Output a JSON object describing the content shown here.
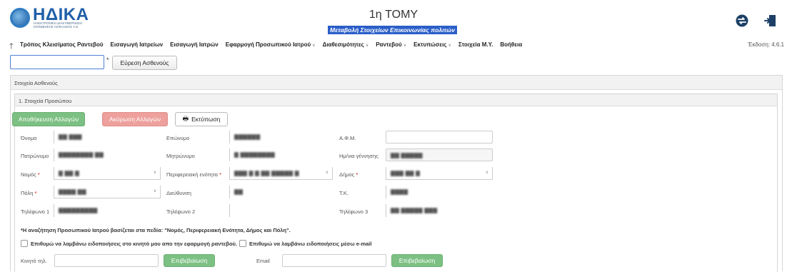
{
  "header": {
    "logo_text": "ΗΔΙΚΑ",
    "logo_subtitle": "ΗΛΕΚΤΡΟΝΙΚΗ ΔΙΑΚΥΒΕΡΝΗΣΗ ΚΟΙΝΩΝΙΚΗΣ ΑΣΦΑΛΙΣΗΣ Α.Ε.",
    "title": "1η TOMY",
    "subtitle": "Μεταβολή Στοιχείων Επικοινωνίας πολιτών",
    "icons": [
      "swap-icon",
      "exit-icon"
    ]
  },
  "menu": {
    "items": [
      {
        "label": "Τρόπος Κλεισίματος Ραντεβού",
        "dropdown": false
      },
      {
        "label": "Εισαγωγή Ιατρείων",
        "dropdown": false
      },
      {
        "label": "Εισαγωγή Ιατρών",
        "dropdown": false
      },
      {
        "label": "Εφαρμογή Προσωπικού Ιατρού",
        "dropdown": true
      },
      {
        "label": "Διαθεσιμότητες",
        "dropdown": true
      },
      {
        "label": "Ραντεβού",
        "dropdown": true
      },
      {
        "label": "Εκτυπώσεις",
        "dropdown": true
      },
      {
        "label": "Στοιχεία Μ.Υ.",
        "dropdown": false
      },
      {
        "label": "Βοήθεια",
        "dropdown": false
      }
    ],
    "version": "Έκδοση: 4.6.1"
  },
  "search": {
    "value": "",
    "required_mark": "*",
    "button_label": "Εύρεση Ασθενούς"
  },
  "patient_panel": {
    "title": "Στοιχεία Ασθενούς",
    "section_title": "1. Στοιχεία Προσώπου",
    "buttons": {
      "save": "Αποθήκευση Αλλαγών",
      "cancel": "Ακύρωση Αλλαγών",
      "print": "Εκτύπωση"
    },
    "fields": {
      "first_name": {
        "label": "Όνομα",
        "value": "▇▇ ▇▇▇"
      },
      "last_name": {
        "label": "Επώνυμο",
        "value": "▇▇▇▇▇▇"
      },
      "afm": {
        "label": "Α.Φ.Μ.",
        "value": ""
      },
      "father_name": {
        "label": "Πατρώνυμο",
        "value": "▇▇▇▇▇▇▇▇ ▇▇"
      },
      "mother_name": {
        "label": "Μητρώνυμο",
        "value": "▇ ▇▇▇▇▇▇▇▇"
      },
      "birth_date": {
        "label": "Ημ/νια γέννησης",
        "value": "▇▇  ▇▇▇▇▇"
      },
      "prefecture": {
        "label": "Νομός",
        "value": "▇ ▇▇ ▇"
      },
      "region_unit": {
        "label": "Περιφερειακή ενότητα",
        "value": "▇▇▇ ▇ ▇ ▇▇ ▇▇▇▇▇ ▇"
      },
      "municipality": {
        "label": "Δήμος",
        "value": "▇▇▇ ▇▇ ▇"
      },
      "city": {
        "label": "Πόλη",
        "value": "▇▇▇▇ ▇▇"
      },
      "address": {
        "label": "Διεύθυνση",
        "value": "▇▇"
      },
      "postal_code": {
        "label": "Τ.Κ.",
        "value": "▇▇▇▇"
      },
      "phone1": {
        "label": "Τηλέφωνο 1",
        "value": "▇▇▇▇▇▇▇▇▇"
      },
      "phone2": {
        "label": "Τηλέφωνο 2",
        "value": ""
      },
      "phone3": {
        "label": "Τηλέφωνο 3",
        "value": "▇▇ ▇▇▇▇▇ ▇▇▇"
      }
    },
    "required_mark": "*",
    "note": "*Η αναζήτηση Προσωπικού Ιατρού βασίζεται στα πεδία: \"Νομός, Περιφερειακή Ενότητα, Δήμος και Πόλη\".",
    "checkboxes": [
      {
        "label": "Επιθυμώ να λαμβάνω ειδοποιήσεις στο κινητό μου απο την εφαρμογή ραντεβού.",
        "checked": false
      },
      {
        "label": "Επιθυμώ να λαμβάνω ειδοποιήσεις μέσω e-mail",
        "checked": false
      }
    ],
    "mobile": {
      "label": "Κινητό τηλ.",
      "value": "",
      "confirm": "Επιβεβαίωση"
    },
    "email": {
      "label": "Email",
      "value": "",
      "confirm": "Επιβεβαίωση"
    }
  },
  "colors": {
    "brand": "#1f5fa8",
    "subtitle_bg": "#2a5ec8",
    "save_button": "#7cc083",
    "cancel_button": "#eda09c"
  }
}
